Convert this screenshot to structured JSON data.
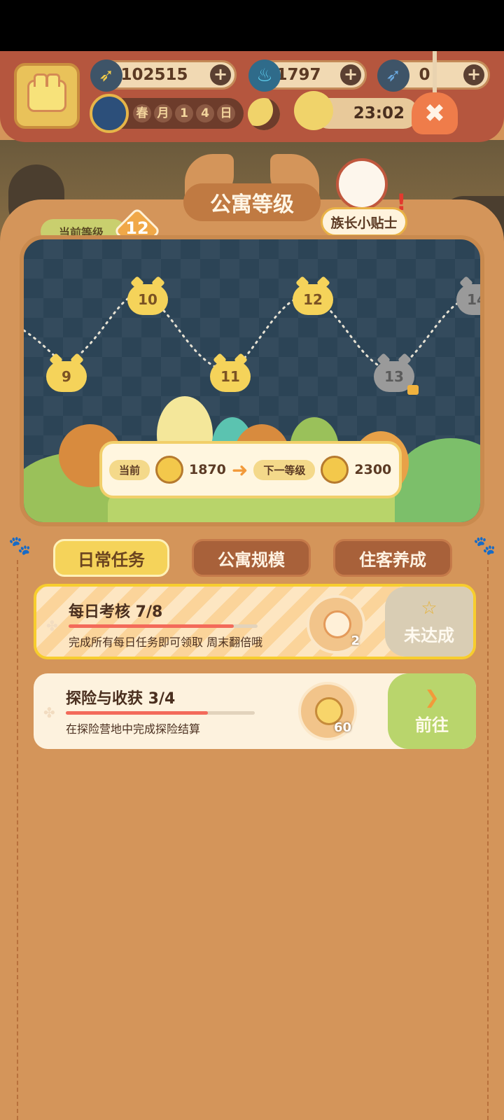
{
  "resources": {
    "bananas": "102515",
    "flames": "1797",
    "fish": "0"
  },
  "calendar": {
    "season": "春",
    "unit": "月",
    "day_digit_1": "1",
    "day_digit_2": "4",
    "day_suffix": "日"
  },
  "clock": {
    "time": "23:02"
  },
  "apartment": {
    "title": "公寓等级",
    "tips_label": "族长小贴士",
    "current_level_label": "当前等级",
    "current_level": "12"
  },
  "map_nodes": [
    "9",
    "10",
    "11",
    "12",
    "13",
    "14"
  ],
  "xp": {
    "current_label": "当前",
    "current_value": "1870",
    "next_label": "下一等级",
    "next_value": "2300"
  },
  "tabs": [
    {
      "label": "日常任务",
      "active": true
    },
    {
      "label": "公寓规模",
      "active": false
    },
    {
      "label": "住客养成",
      "active": false
    }
  ],
  "tasks": [
    {
      "title": "每日考核  7/8",
      "progress": 0.875,
      "description": "完成所有每日任务即可领取 周末翻倍哦",
      "reward_count": "2",
      "reward_icon": "paw-key-icon",
      "status_label": "未达成",
      "status_icon": "star-outline-icon"
    },
    {
      "title": "探险与收获  3/4",
      "progress": 0.75,
      "description": "在探险营地中完成探险结算",
      "reward_count": "60",
      "reward_icon": "sun-coin-icon",
      "status_label": "前往",
      "status_icon": "arrow-right-icon"
    }
  ],
  "colors": {
    "panel": "#d4955a",
    "tab_active": "#f5d35a",
    "tab_inactive": "#a8613a",
    "progress_bar": "#f36a5a",
    "go_button": "#b9d56c"
  }
}
